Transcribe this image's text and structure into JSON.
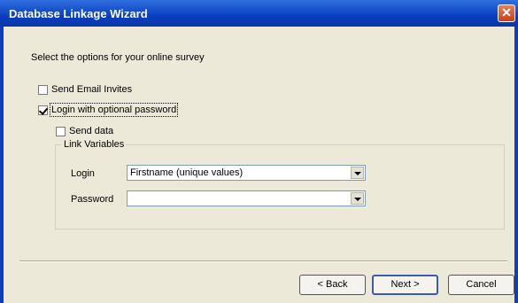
{
  "window": {
    "title": "Database Linkage Wizard"
  },
  "instructions": "Select the options for your online survey",
  "options": [
    {
      "label": "Send Email Invites",
      "checked": false
    },
    {
      "label": "Login with optional password",
      "checked": true
    },
    {
      "label": "Send data",
      "checked": false
    }
  ],
  "link_variables": {
    "title": "Link Variables",
    "login_label": "Login",
    "login_value": "Firstname (unique values)",
    "password_label": "Password",
    "password_value": ""
  },
  "buttons": {
    "back": "< Back",
    "next": "Next >",
    "cancel": "Cancel"
  }
}
